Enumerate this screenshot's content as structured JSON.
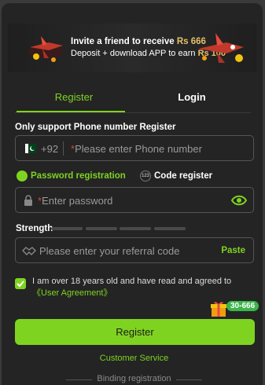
{
  "banner": {
    "line1_prefix": "Invite a friend to receive",
    "line1_amount": "Rs 666",
    "line2_prefix": "Deposit + download APP to earn",
    "line2_amount": "Rs 100"
  },
  "tabs": {
    "register": "Register",
    "login": "Login"
  },
  "form": {
    "support_text": "Only support Phone number Register",
    "phone": {
      "country_code": "+92",
      "placeholder": "Please enter Phone number"
    },
    "modes": {
      "password": "Password registration",
      "code": "Code register"
    },
    "password": {
      "placeholder": "Enter password"
    },
    "strength_label": "Strength",
    "referral": {
      "placeholder": "Please enter your referral code",
      "paste_label": "Paste"
    },
    "agreement": {
      "text": "I am over 18 years old and have read and agreed to",
      "link": "《User Agreement》"
    },
    "gift_badge": "30-666",
    "submit_label": "Register",
    "customer_service": "Customer Service",
    "binding": "Binding registration"
  },
  "colors": {
    "accent": "#7ed321",
    "background": "#242424",
    "required": "#e04040"
  }
}
